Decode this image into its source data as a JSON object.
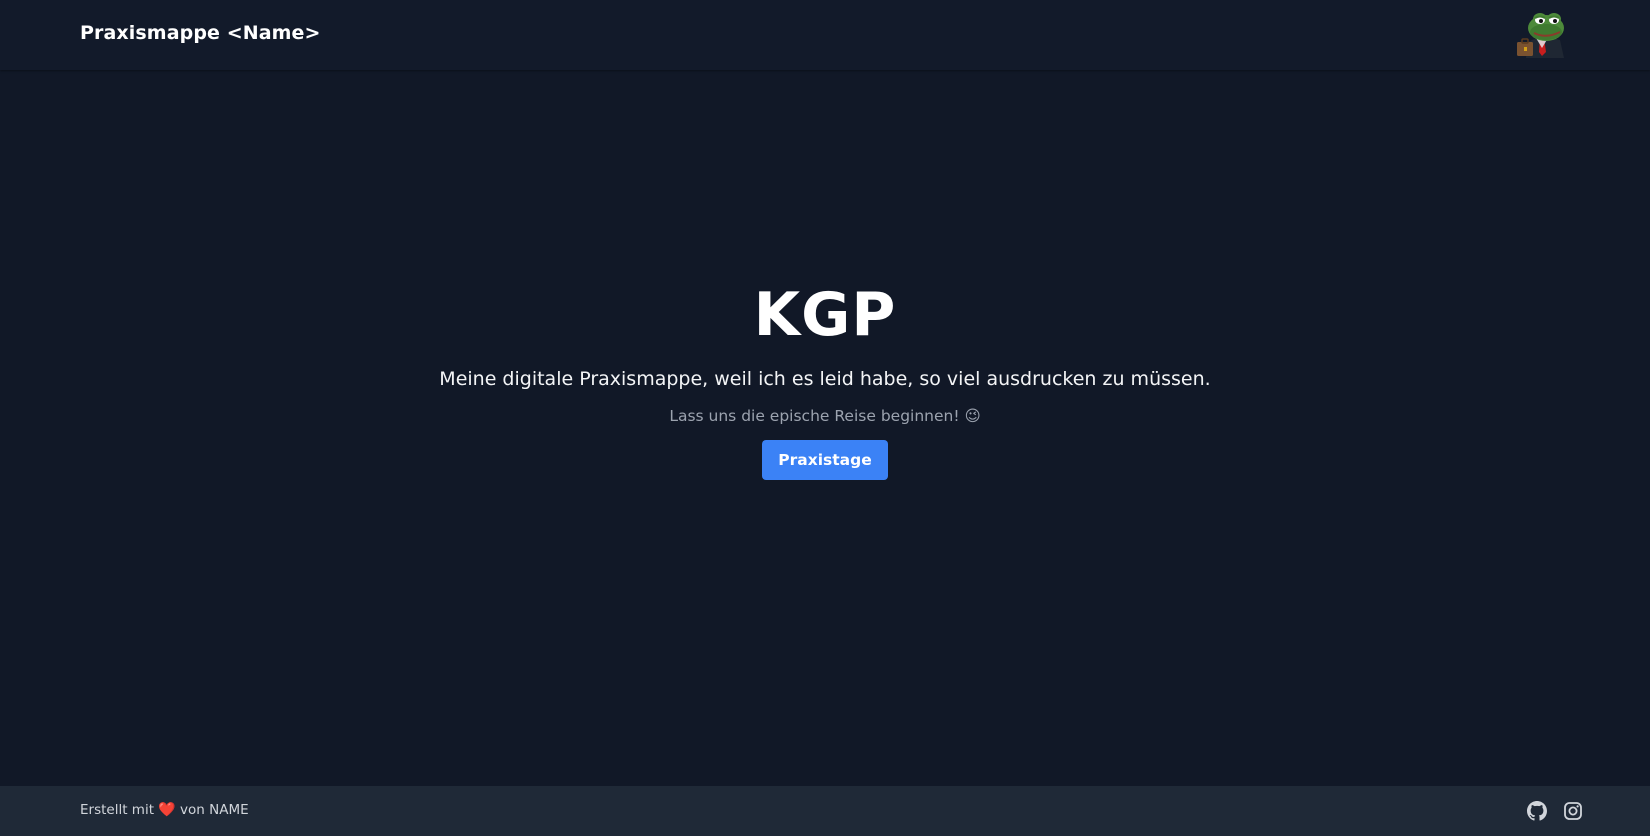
{
  "header": {
    "brand": "Praxismappe <Name>",
    "avatar_icon": "frog-avatar-icon"
  },
  "hero": {
    "title": "KGP",
    "subtitle": "Meine digitale Praxismappe, weil ich es leid habe, so viel ausdrucken zu müssen.",
    "tagline": "Lass uns die epische Reise beginnen!",
    "tagline_emoji": "😉",
    "button_label": "Praxistage"
  },
  "footer": {
    "text_before": "Erstellt mit",
    "heart": "❤️",
    "text_after": "von NAME",
    "icons": [
      "github-icon",
      "instagram-icon"
    ]
  },
  "colors": {
    "background": "#111827",
    "navbar": "#121a2a",
    "footer": "#1f2937",
    "accent": "#3b82f6"
  }
}
